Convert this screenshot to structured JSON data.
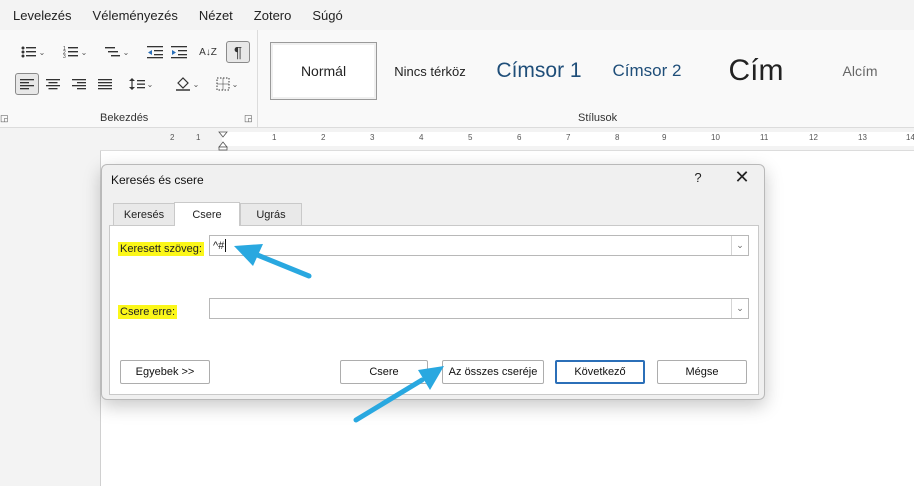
{
  "menu": [
    "Levelezés",
    "Véleményezés",
    "Nézet",
    "Zotero",
    "Súgó"
  ],
  "ribbon": {
    "paragraph_label": "Bekezdés",
    "styles_label": "Stílusok",
    "show_marks": "¶",
    "sort": "A↓Z",
    "styles": [
      {
        "label": "Normál"
      },
      {
        "label": "Nincs térköz"
      },
      {
        "label": "Címsor 1"
      },
      {
        "label": "Címsor 2"
      },
      {
        "label": "Cím"
      },
      {
        "label": "Alcím"
      }
    ]
  },
  "ruler": {
    "ticks": [
      "2",
      "1",
      "1",
      "2",
      "3",
      "4",
      "5",
      "6",
      "7",
      "8",
      "9",
      "10",
      "11",
      "12",
      "13",
      "14"
    ]
  },
  "dialog": {
    "title": "Keresés és csere",
    "help": "?",
    "close": "✕",
    "tabs": [
      "Keresés",
      "Csere",
      "Ugrás"
    ],
    "find_label": "Keresett szöveg:",
    "find_value": "^#",
    "replace_label": "Csere erre:",
    "replace_value": "",
    "buttons": {
      "more": "Egyebek >>",
      "replace": "Csere",
      "replace_all": "Az összes cseréje",
      "next": "Következő",
      "cancel": "Mégse"
    }
  },
  "colors": {
    "highlight": "#fbf719",
    "arrow": "#29a8e0",
    "default_button": "#2b6fb8"
  }
}
